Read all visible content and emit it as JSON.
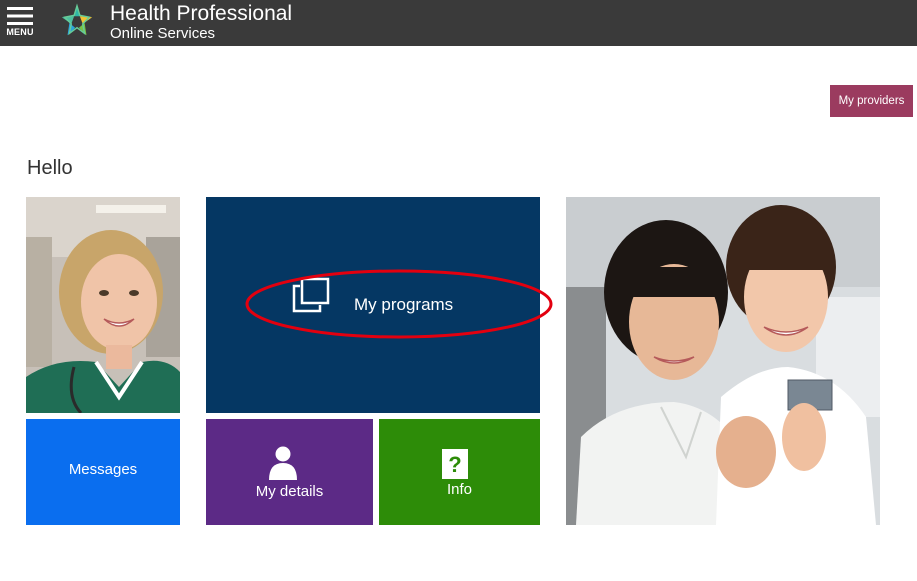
{
  "header": {
    "menu_label": "MENU",
    "brand_title": "Health Professional",
    "brand_subtitle": "Online Services",
    "bg_color": "#3a3a3a"
  },
  "actions": {
    "my_providers_label": "My providers",
    "my_providers_color": "#9b3b5f"
  },
  "greeting": "Hello",
  "tiles": {
    "programs": {
      "label": "My programs",
      "icon": "copy-icon",
      "color": "#053763",
      "highlighted": true
    },
    "messages": {
      "label": "Messages",
      "color": "#0a6eef"
    },
    "details": {
      "label": "My details",
      "icon": "person-icon",
      "color": "#5c2a86"
    },
    "info": {
      "label": "Info",
      "icon": "help-icon",
      "color": "#2d8c08"
    },
    "photo_left": {
      "description_icon": "nurse-photo"
    },
    "photo_right": {
      "description_icon": "dental-staff-photo"
    }
  },
  "annotation": {
    "color": "#e3000f",
    "shape": "ellipse"
  }
}
